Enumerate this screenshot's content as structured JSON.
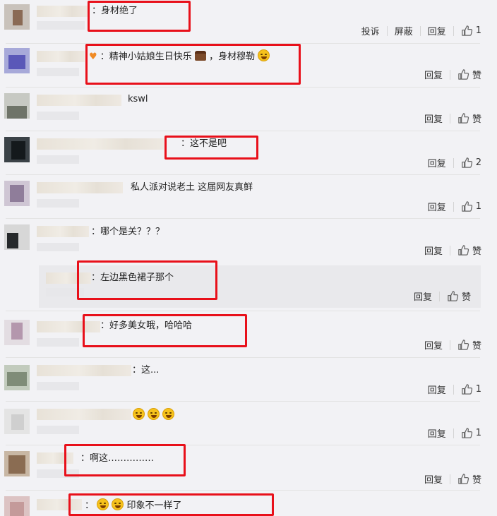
{
  "labels": {
    "report": "投诉",
    "block": "屏蔽",
    "reply": "回复",
    "like": "赞"
  },
  "comments": [
    {
      "text": "：身材绝了",
      "likes": "1"
    },
    {
      "text": "：精神小姑娘生日快乐",
      "text2": "，身材穆勒",
      "likes": "赞"
    },
    {
      "text": "kswl",
      "likes": "赞"
    },
    {
      "text": "：这不是吧",
      "likes": "2"
    },
    {
      "text": "私人派对说老土 这届网友真鲜",
      "likes": "1"
    },
    {
      "text": "：哪个是关？？？",
      "likes": "赞"
    },
    {
      "text": "：左边黑色裙子那个",
      "likes": "赞"
    },
    {
      "text": "：好多美女哦，哈哈哈",
      "likes": "赞"
    },
    {
      "text": "：这...",
      "likes": "1"
    },
    {
      "text": "：",
      "likes": "1"
    },
    {
      "text": "：啊这……………",
      "likes": "赞"
    },
    {
      "text": "印象不一样了",
      "likes": ""
    }
  ],
  "colors": {
    "highlight_box": "#e8101a",
    "background": "#f2f2f5"
  },
  "icons": [
    "thumbs-up-icon",
    "cake-emoji-icon",
    "laughing-emoji-icon",
    "grinning-emoji-icon",
    "tears-of-joy-emoji-icon"
  ]
}
